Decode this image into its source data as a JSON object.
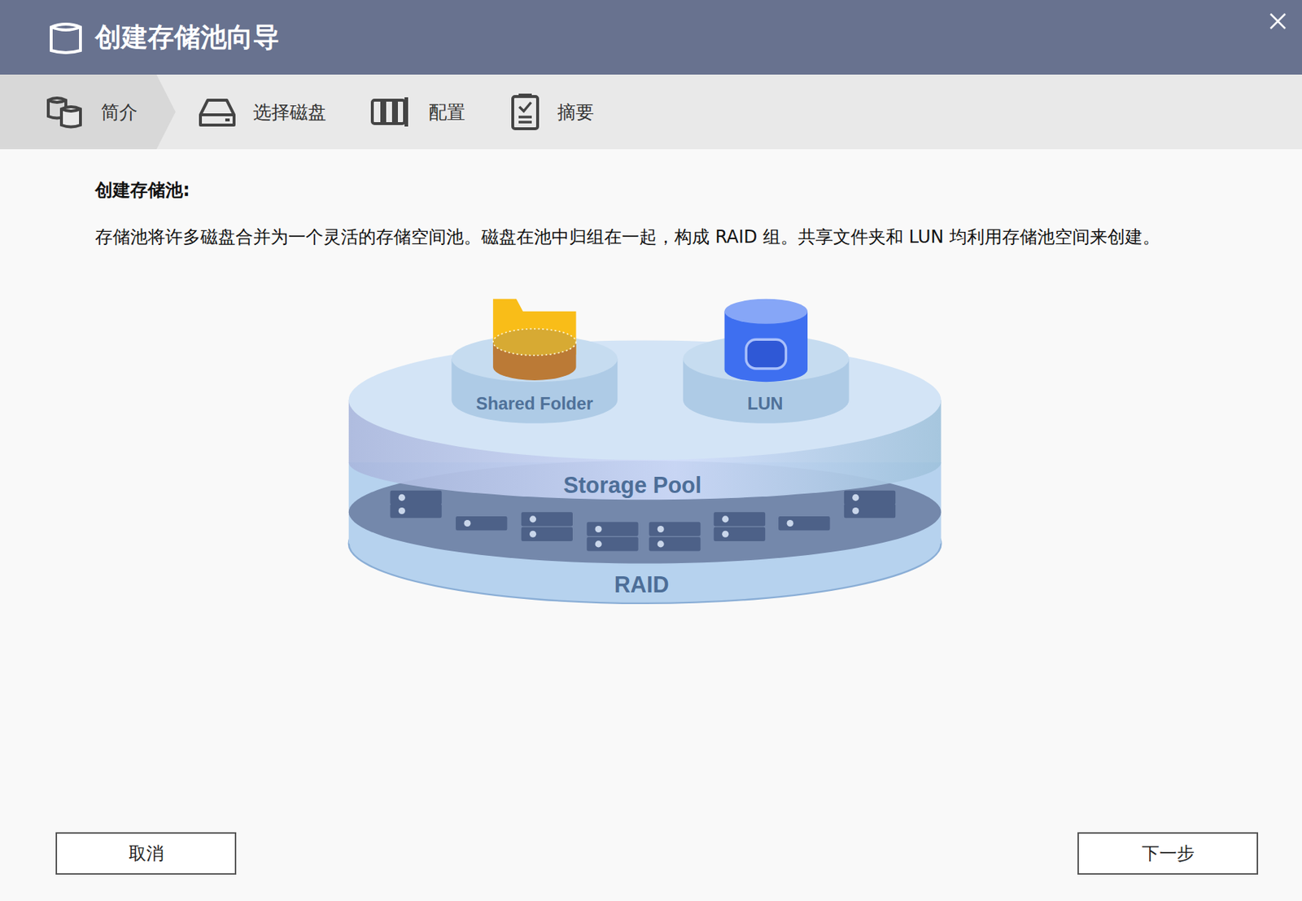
{
  "window": {
    "title": "创建存储池向导"
  },
  "steps": [
    {
      "label": "简介",
      "selected": true
    },
    {
      "label": "选择磁盘",
      "selected": false
    },
    {
      "label": "配置",
      "selected": false
    },
    {
      "label": "摘要",
      "selected": false
    }
  ],
  "content": {
    "heading": "创建存储池:",
    "description": "存储池将许多磁盘合并为一个灵活的存储空间池。磁盘在池中归组在一起，构成 RAID 组。共享文件夹和 LUN 均利用存储池空间来创建。"
  },
  "diagram": {
    "shared_folder": "Shared Folder",
    "lun": "LUN",
    "storage_pool": "Storage Pool",
    "raid": "RAID"
  },
  "buttons": [
    {
      "label": "取消"
    },
    {
      "label": "下一步"
    }
  ]
}
